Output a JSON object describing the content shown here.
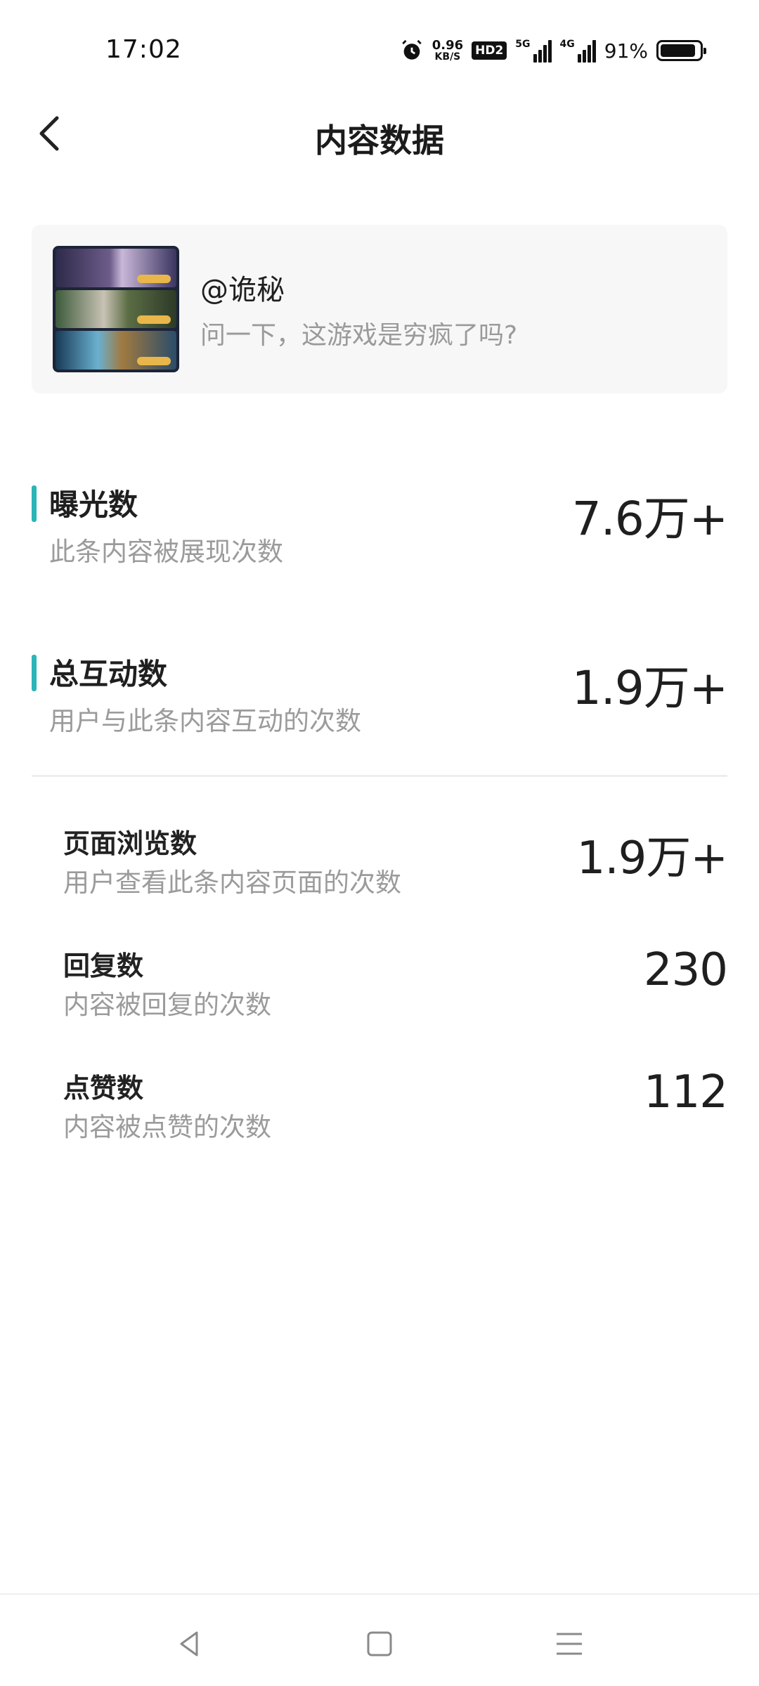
{
  "status_bar": {
    "time": "17:02",
    "net_speed_value": "0.96",
    "net_speed_unit": "KB/S",
    "hd_badge": "HD2",
    "signal1_tag": "5G",
    "signal2_tag": "4G",
    "battery_percent": "91%",
    "battery_level": 0.91,
    "icons": [
      "alarm-icon",
      "hd-icon",
      "signal-5g-icon",
      "signal-4g-icon",
      "battery-icon"
    ]
  },
  "header": {
    "title": "内容数据",
    "back_icon": "chevron-left-icon"
  },
  "post": {
    "author": "@诡秘",
    "excerpt": "问一下，这游戏是穷疯了吗?"
  },
  "metrics": [
    {
      "label": "曝光数",
      "description": "此条内容被展现次数",
      "value": "7.6万+"
    },
    {
      "label": "总互动数",
      "description": "用户与此条内容互动的次数",
      "value": "1.9万+"
    }
  ],
  "sub_metrics": [
    {
      "label": "页面浏览数",
      "description": "用户查看此条内容页面的次数",
      "value": "1.9万+"
    },
    {
      "label": "回复数",
      "description": "内容被回复的次数",
      "value": "230"
    },
    {
      "label": "点赞数",
      "description": "内容被点赞的次数",
      "value": "112"
    }
  ],
  "colors": {
    "accent": "#2bb5b8",
    "text_primary": "#1f1f1f",
    "text_secondary": "#9b9b9b",
    "card_bg": "#f7f7f7"
  },
  "nav_bar": {
    "icons": [
      "nav-back-icon",
      "nav-home-icon",
      "nav-menu-icon"
    ]
  }
}
